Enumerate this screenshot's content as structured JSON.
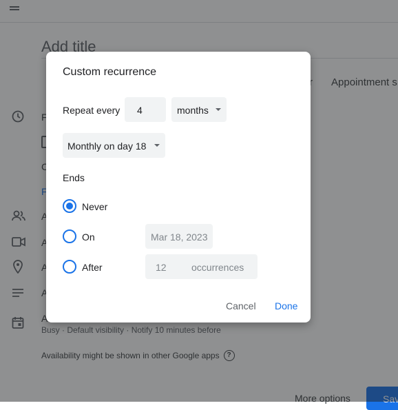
{
  "background": {
    "title_placeholder": "Add title",
    "tabs": [
      "r",
      "Appointment s"
    ],
    "side_texts": [
      "F",
      "C",
      "F",
      "A",
      "A",
      "A",
      "A",
      "A"
    ],
    "meta_line": "Busy · Default visibility · Notify 10 minutes before",
    "availability_note": "Availability might be shown in other Google apps",
    "help_glyph": "?",
    "more_options": "More options",
    "save_label": "Sav"
  },
  "dialog": {
    "title": "Custom recurrence",
    "repeat_label": "Repeat every",
    "repeat_count": "4",
    "repeat_unit": "months",
    "monthly_option": "Monthly on day 18",
    "ends_label": "Ends",
    "options": {
      "never": "Never",
      "on": "On",
      "after": "After"
    },
    "selected_end": "never",
    "on_date": "Mar 18, 2023",
    "after_count": "12",
    "after_unit": "occurrences",
    "cancel": "Cancel",
    "done": "Done"
  },
  "colors": {
    "accent": "#1a73e8",
    "scrim": "rgba(32,33,36,0.5)",
    "field_bg": "#f1f3f4"
  }
}
